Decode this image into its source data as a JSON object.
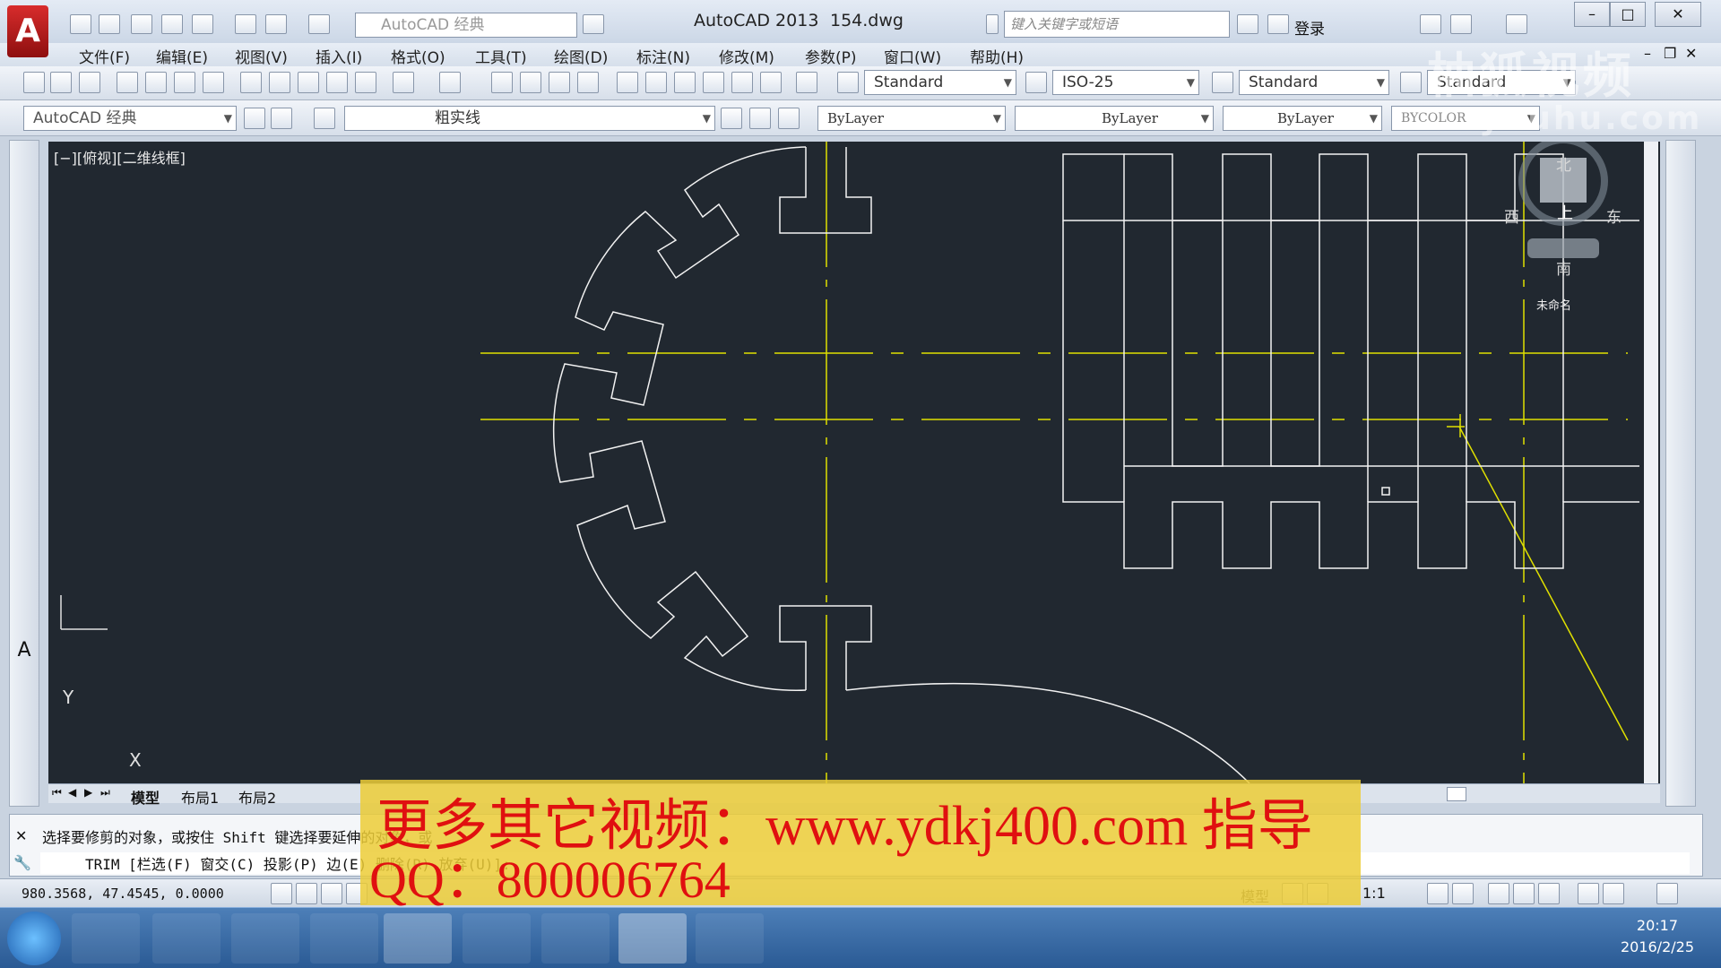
{
  "titlebar": {
    "logo": "A",
    "workspace": "AutoCAD 经典",
    "app_title": "AutoCAD 2013",
    "file_name": "154.dwg",
    "search_placeholder": "键入关键字或短语",
    "login": "登录"
  },
  "menu": [
    "文件(F)",
    "编辑(E)",
    "视图(V)",
    "插入(I)",
    "格式(O)",
    "工具(T)",
    "绘图(D)",
    "标注(N)",
    "修改(M)",
    "参数(P)",
    "窗口(W)",
    "帮助(H)"
  ],
  "styles_toolbar": {
    "text_style": "Standard",
    "dim_style": "ISO-25",
    "table_style": "Standard",
    "mleader_style": "Standard"
  },
  "layers_toolbar": {
    "workspace": "AutoCAD 经典",
    "layer": "粗实线",
    "color": "ByLayer",
    "linetype": "ByLayer",
    "lineweight": "ByLayer",
    "plotstyle": "BYCOLOR"
  },
  "viewport": {
    "label": "[−][俯视][二维线框]",
    "viewcube": {
      "north": "北",
      "south": "南",
      "east": "东",
      "west": "西",
      "top": "上",
      "wcs": "未命名"
    }
  },
  "ucs": {
    "y": "Y",
    "x": "X"
  },
  "tabs": [
    "模型",
    "布局1",
    "布局2"
  ],
  "command": {
    "history": "选择要修剪的对象，或按住 Shift 键选择要延伸的对象，或",
    "current": "TRIM [栏选(F) 窗交(C) 投影(P) 边(E) 删除(R) 放弃(U)]:"
  },
  "status": {
    "coords": "980.3568, 47.4545, 0.0000",
    "model": "模型",
    "scale": "1:1"
  },
  "watermark": {
    "line1": "更多其它视频：www.ydkj400.com 指导",
    "line2": "QQ：800006764",
    "brand": "柚狐视频",
    "brand_url": "youhu.com"
  },
  "taskbar": {
    "time": "20:17",
    "date": "2016/2/25"
  },
  "colors": {
    "canvas": "#212830",
    "geometry": "#ffffff",
    "centerline": "#e0e000",
    "promo_bg": "#ecd037",
    "promo_text": "#e01010"
  }
}
